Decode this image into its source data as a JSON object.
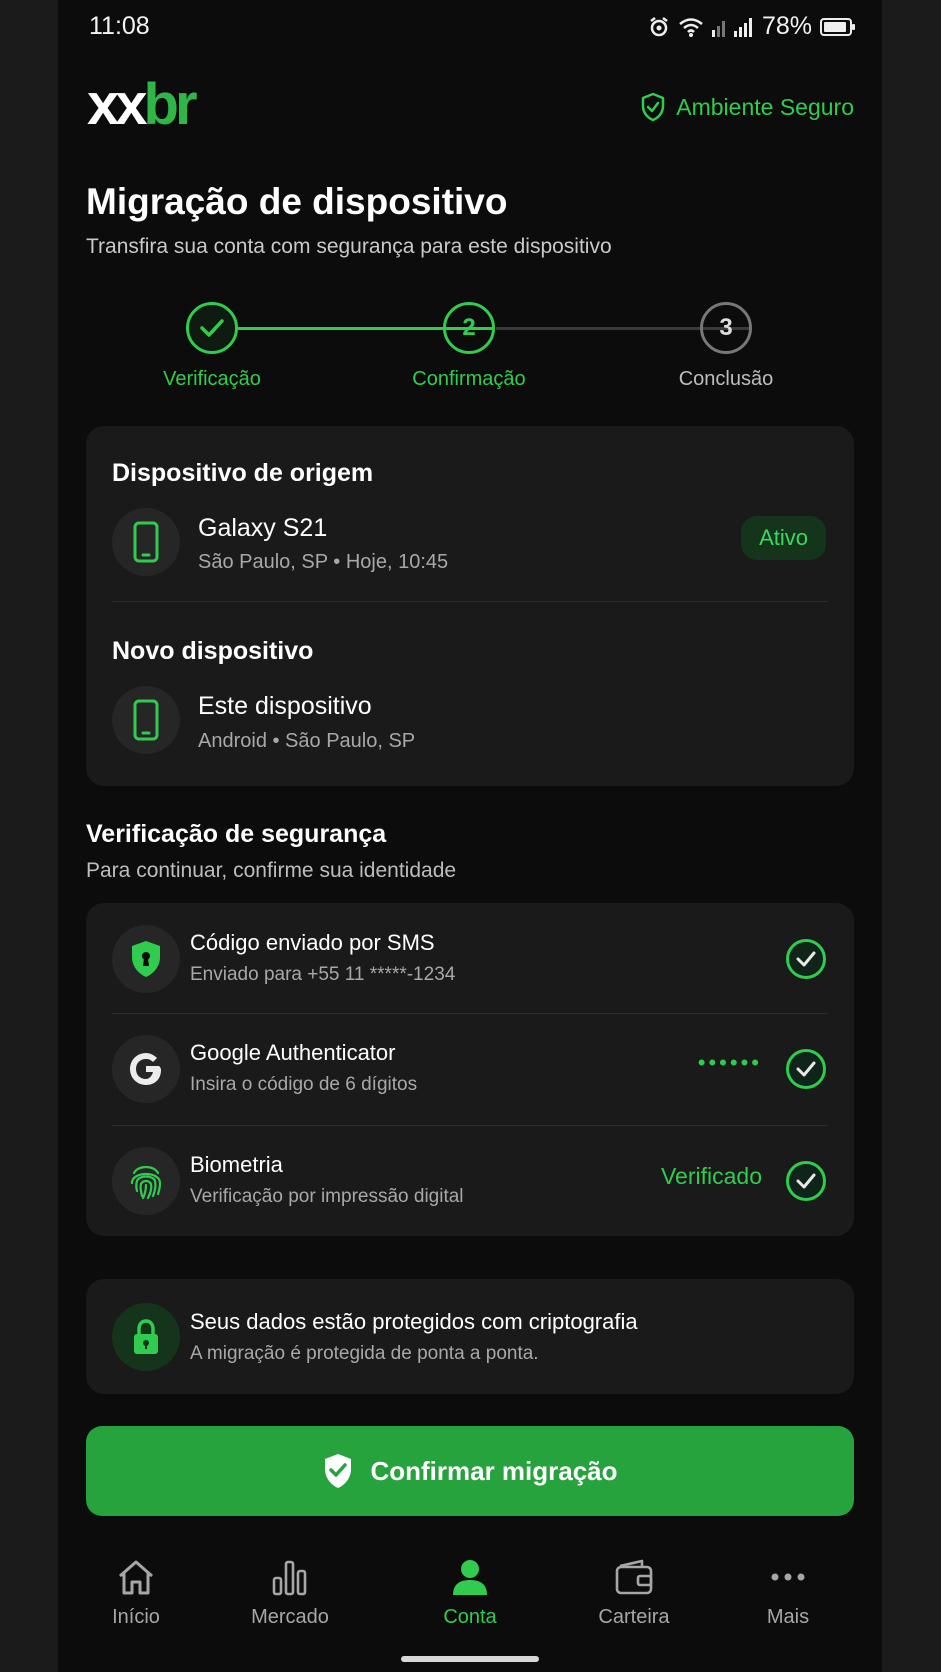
{
  "status_bar": {
    "time": "11:08",
    "battery": "78%"
  },
  "header": {
    "logo_a": "xx",
    "logo_b": "br",
    "secure_label": "Ambiente Seguro"
  },
  "page": {
    "title": "Migração de dispositivo",
    "subtitle": "Transfira sua conta com segurança para este dispositivo"
  },
  "stepper": {
    "steps": [
      {
        "label": "Verificação",
        "number": "",
        "state": "done"
      },
      {
        "label": "Confirmação",
        "number": "2",
        "state": "active"
      },
      {
        "label": "Conclusão",
        "number": "3",
        "state": "pending"
      }
    ]
  },
  "devices": {
    "origin_heading": "Dispositivo de origem",
    "origin_name": "Galaxy S21",
    "origin_detail": "São Paulo, SP • Hoje, 10:45",
    "origin_badge": "Ativo",
    "new_heading": "Novo dispositivo",
    "new_name": "Este dispositivo",
    "new_detail": "Android • São Paulo, SP"
  },
  "security": {
    "heading": "Verificação de segurança",
    "subheading": "Para continuar, confirme sua identidade",
    "items": [
      {
        "title": "Código enviado por SMS",
        "subtitle": "Enviado para +55 11 *****-1234",
        "status": "",
        "icon": "shield-icon"
      },
      {
        "title": "Google Authenticator",
        "subtitle": "Insira o código de 6 dígitos",
        "status": "••••••",
        "icon": "google-icon"
      },
      {
        "title": "Biometria",
        "subtitle": "Verificação por impressão digital",
        "status": "Verificado",
        "icon": "fingerprint-icon"
      }
    ]
  },
  "encryption": {
    "title": "Seus dados estão protegidos com criptografia",
    "subtitle": "A migração é protegida de ponta a ponta."
  },
  "cta": {
    "label": "Confirmar migração"
  },
  "nav": {
    "items": [
      {
        "label": "Início",
        "icon": "home-icon"
      },
      {
        "label": "Mercado",
        "icon": "bar-chart-icon"
      },
      {
        "label": "Conta",
        "icon": "user-icon",
        "active": true
      },
      {
        "label": "Carteira",
        "icon": "wallet-icon"
      },
      {
        "label": "Mais",
        "icon": "more-icon"
      }
    ]
  },
  "colors": {
    "accent": "#2fcc4f",
    "button": "#27a33e",
    "background": "#0c0c0c",
    "card": "#1a1a1a"
  }
}
